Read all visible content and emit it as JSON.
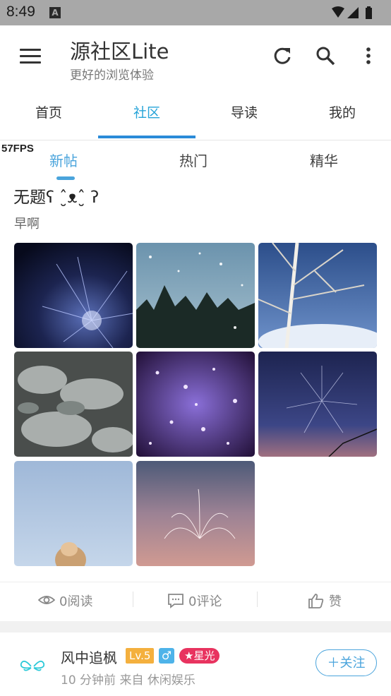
{
  "status_bar": {
    "time": "8:49",
    "notification_icon": "A"
  },
  "app": {
    "title": "源社区Lite",
    "subtitle": "更好的浏览体验"
  },
  "toolbar_icons": [
    "refresh-icon",
    "search-icon",
    "more-vert-icon"
  ],
  "tabs": [
    {
      "label": "首页"
    },
    {
      "label": "社区"
    },
    {
      "label": "导读"
    },
    {
      "label": "我的"
    }
  ],
  "active_tab": "社区",
  "fps": "57FPS",
  "subtabs": [
    {
      "label": "新帖"
    },
    {
      "label": "热门"
    },
    {
      "label": "精华"
    }
  ],
  "active_subtab": "新帖",
  "post": {
    "title": "无题ʕ ˆ̮ᴥˆ̮ ʔ",
    "body": "早啊",
    "images": [
      "fireworks-blue",
      "snowy-trees",
      "birch-branches",
      "frosted-pine",
      "purple-sparkles",
      "firework-dusk",
      "blue-sky",
      "firework-pink-sky"
    ],
    "stats": {
      "reads": "0阅读",
      "comments": "0评论",
      "like": "赞"
    }
  },
  "user": {
    "name": "风中追枫",
    "level": "Lv.5",
    "gender_symbol": "♂",
    "badge": "★星光",
    "meta": "10 分钟前  来自 休闲娱乐",
    "follow_label": "＋关注"
  },
  "colors": {
    "accent": "#25a3d8",
    "indicator": "#2a8bd8",
    "level": "#f4b03e",
    "badge": "#e8335f"
  }
}
